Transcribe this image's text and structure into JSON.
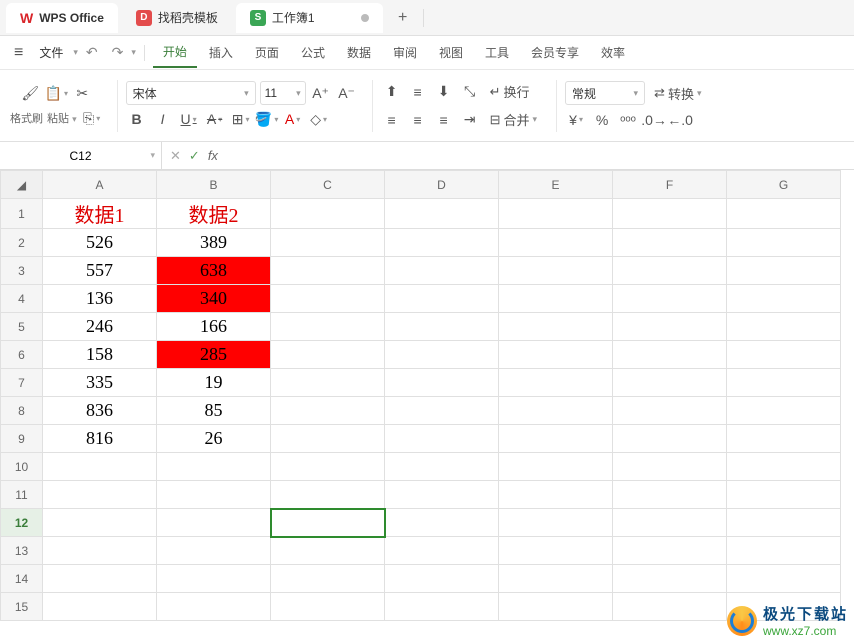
{
  "title_bar": {
    "app_name": "WPS Office",
    "tabs": [
      {
        "label": "找稻壳模板",
        "icon_bg": "#e34c4c",
        "icon_txt": "D"
      },
      {
        "label": "工作簿1",
        "icon_bg": "#3aa655",
        "icon_txt": "S",
        "active": true,
        "dirty": true
      }
    ],
    "new_tab": "+"
  },
  "menu": {
    "file": "文件",
    "items": [
      "开始",
      "插入",
      "页面",
      "公式",
      "数据",
      "审阅",
      "视图",
      "工具",
      "会员专享",
      "效率"
    ],
    "active_index": 0
  },
  "ribbon": {
    "format_painter": "格式刷",
    "paste": "粘贴",
    "font_name": "宋体",
    "font_size": "11",
    "wrap": "换行",
    "merge": "合并",
    "number_format": "常规",
    "convert": "转换"
  },
  "formula_bar": {
    "name_box": "C12",
    "fx_label": "fx",
    "formula": ""
  },
  "grid": {
    "columns": [
      "A",
      "B",
      "C",
      "D",
      "E",
      "F",
      "G"
    ],
    "row_count": 15,
    "header_row": {
      "A": "数据1",
      "B": "数据2"
    },
    "data": [
      {
        "A": "数据1",
        "B": "数据2",
        "hdr": true
      },
      {
        "A": 526,
        "B": 389
      },
      {
        "A": 557,
        "B": 638,
        "hl_b": true
      },
      {
        "A": 136,
        "B": 340,
        "hl_b": true
      },
      {
        "A": 246,
        "B": 166
      },
      {
        "A": 158,
        "B": 285,
        "hl_b": true
      },
      {
        "A": 335,
        "B": 19
      },
      {
        "A": 836,
        "B": 85
      },
      {
        "A": 816,
        "B": 26
      }
    ],
    "selected": {
      "row": 12,
      "col": "C"
    }
  },
  "watermark": {
    "cn": "极光下载站",
    "url": "www.xz7.com"
  }
}
